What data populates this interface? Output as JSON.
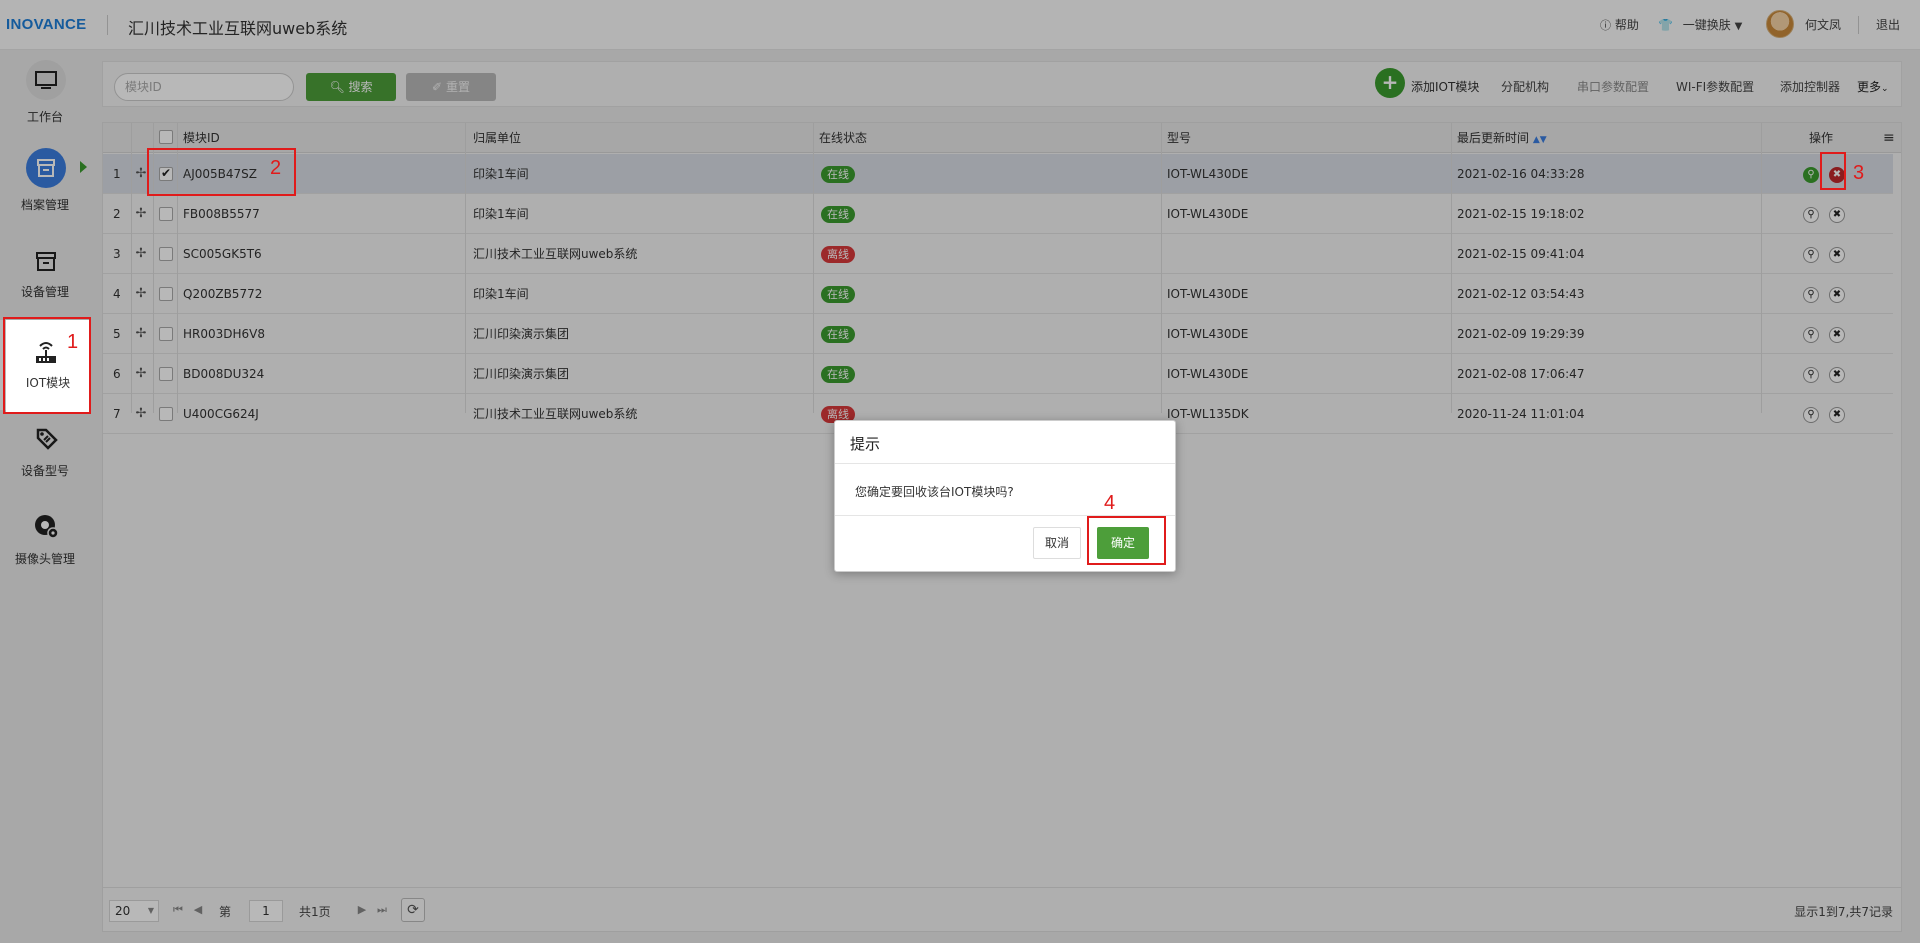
{
  "header": {
    "logo": "INOVANCE",
    "app_title": "汇川技术工业互联网uweb系统",
    "help": "帮助",
    "theme": "一键换肤",
    "user_name": "何文凤",
    "logout": "退出"
  },
  "sidebar": {
    "items": [
      {
        "label": "工作台",
        "icon": "monitor-icon"
      },
      {
        "label": "档案管理",
        "icon": "archive-icon"
      },
      {
        "label": "设备管理",
        "icon": "box-icon"
      },
      {
        "label": "IOT模块",
        "icon": "router-icon"
      },
      {
        "label": "设备型号",
        "icon": "tag-icon"
      },
      {
        "label": "摄像头管理",
        "icon": "camera-icon"
      }
    ]
  },
  "toolbar": {
    "search_placeholder": "模块ID",
    "search_label": "搜索",
    "reset_label": "重置",
    "add_iot": "添加IOT模块",
    "assign_org": "分配机构",
    "serial_config": "串口参数配置",
    "wifi_config": "WI-FI参数配置",
    "add_controller": "添加控制器",
    "more": "更多"
  },
  "table": {
    "columns": [
      "模块ID",
      "归属单位",
      "在线状态",
      "型号",
      "最后更新时间",
      "操作"
    ],
    "rows": [
      {
        "num": "1",
        "id": "AJ005B47SZ",
        "unit": "印染1车间",
        "status": "在线",
        "model": "IOT-WL430DE",
        "time": "2021-02-16 04:33:28"
      },
      {
        "num": "2",
        "id": "FB008B5577",
        "unit": "印染1车间",
        "status": "在线",
        "model": "IOT-WL430DE",
        "time": "2021-02-15 19:18:02"
      },
      {
        "num": "3",
        "id": "SC005GK5T6",
        "unit": "汇川技术工业互联网uweb系统",
        "status": "离线",
        "model": "",
        "time": "2021-02-15 09:41:04"
      },
      {
        "num": "4",
        "id": "Q200ZB5772",
        "unit": "印染1车间",
        "status": "在线",
        "model": "IOT-WL430DE",
        "time": "2021-02-12 03:54:43"
      },
      {
        "num": "5",
        "id": "HR003DH6V8",
        "unit": "汇川印染演示集团",
        "status": "在线",
        "model": "IOT-WL430DE",
        "time": "2021-02-09 19:29:39"
      },
      {
        "num": "6",
        "id": "BD008DU324",
        "unit": "汇川印染演示集团",
        "status": "在线",
        "model": "IOT-WL430DE",
        "time": "2021-02-08 17:06:47"
      },
      {
        "num": "7",
        "id": "U400CG624J",
        "unit": "汇川技术工业互联网uweb系统",
        "status": "离线",
        "model": "IOT-WL135DK",
        "time": "2020-11-24 11:01:04"
      }
    ]
  },
  "pager": {
    "page_size": "20",
    "page_prefix": "第",
    "page_value": "1",
    "page_total": "共1页",
    "summary": "显示1到7,共7记录"
  },
  "dialog": {
    "title": "提示",
    "message": "您确定要回收该台IOT模块吗?",
    "cancel": "取消",
    "ok": "确定"
  },
  "annotations": [
    "1",
    "2",
    "3",
    "4"
  ],
  "colors": {
    "brand_blue": "#1e7ed8",
    "green": "#3b9b2e",
    "red": "#d9393b",
    "annotation_red": "#e01b1b"
  }
}
